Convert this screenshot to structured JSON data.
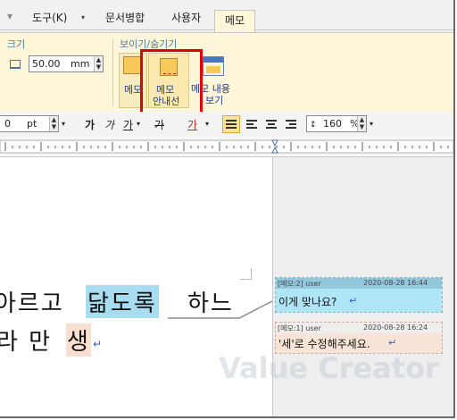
{
  "menu_tabs": [
    {
      "label": "도구(K)",
      "dropdown": "▾"
    },
    {
      "label": "문서병합"
    },
    {
      "label": "사용자"
    },
    {
      "label": "메모",
      "active": true
    }
  ],
  "ribbon": {
    "size_group_label": "크기",
    "size_value": "50.00",
    "size_unit": "mm",
    "show_hide_group_label": "보이기/숨기기",
    "memo_button_label": "메모",
    "memo_guide_button_label_1": "메모",
    "memo_guide_button_label_2": "안내선",
    "memo_content_button_label_1": "메모 내용",
    "memo_content_button_label_2": "보기"
  },
  "toolbar": {
    "font_size_value": "0",
    "font_size_unit": "pt",
    "bold_label": "가",
    "italic_label": "가",
    "underline_label": "가",
    "strike_label": "가",
    "color_label": "가",
    "line_spacing_icon_label": "↕",
    "line_spacing_value": "160",
    "line_spacing_unit": "%"
  },
  "document": {
    "line1_prefix": "아르고",
    "line1_highlight": "닮도록",
    "line1_suffix": "하느",
    "line2_prefix": "라 만",
    "line2_highlight": "생",
    "paragraph_mark": "↵"
  },
  "memos": [
    {
      "header_label": "[메모:2] user",
      "timestamp": "2020-08-28 16:44",
      "text": "이게 맞나요?"
    },
    {
      "header_label": "[메모:1] user",
      "timestamp": "2020-08-28 16:24",
      "text": "'세'로 수정해주세요."
    }
  ],
  "watermark": "Value Creator",
  "colors": {
    "ribbon_bg": "#fdf6d9",
    "highlight_red": "#e00000",
    "memo2_header": "#92c7dc",
    "memo2_body": "#aee6f8",
    "memo1_body": "#f8e4d7",
    "text_highlight_blue": "#a8dcf0",
    "text_highlight_peach": "#f7dfd1"
  }
}
